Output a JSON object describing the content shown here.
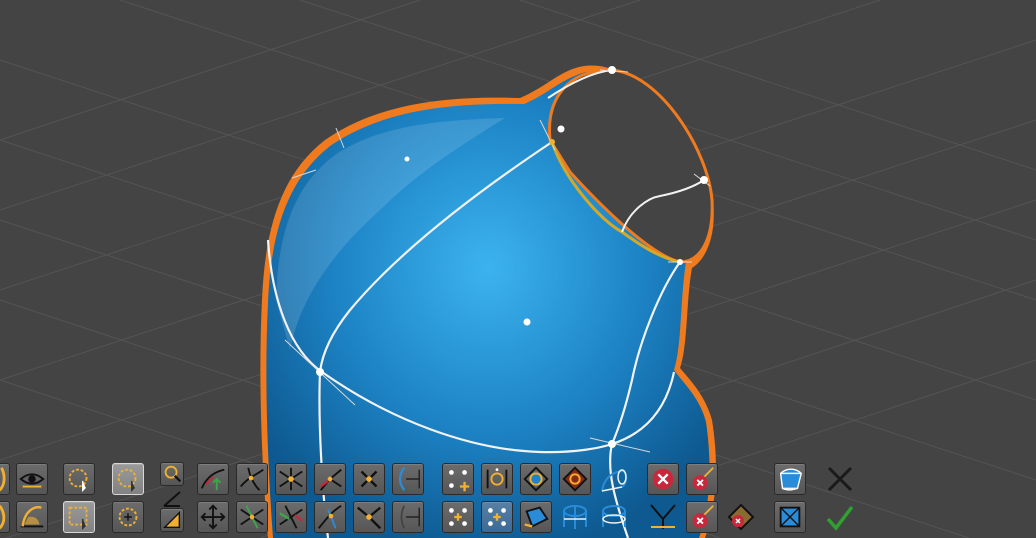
{
  "viewport": {
    "background": "#444444",
    "grid_color": "#555555",
    "surface_colors": [
      "#1e86c8",
      "#3db4ee",
      "#0f5a8e"
    ],
    "outline_color": "#f07b1f",
    "curve_color": "#f2f2f2"
  },
  "toolbar": {
    "top_row": [
      "curve-tool-icon",
      "eye-view-icon",
      "circle-select-icon",
      "circle-lasso-select-icon",
      "zoom-select-icon",
      "free-draw-icon",
      "crossing-curves-icon",
      "snap-point-icon",
      "split-curve-icon",
      "pin-point-icon",
      "straight-edge-icon",
      "point-selection-icon",
      "circle-point-icon",
      "circle-patch-icon",
      "red-patch-icon",
      "cone-surface-icon",
      "delete-x-icon",
      "delete-point-icon",
      "patch-edit-icon",
      "cancel-icon"
    ],
    "bottom_row": [
      "tilt-curve-icon",
      "arc-tool-icon",
      "rectangle-select-icon",
      "dashed-circle-select-icon",
      "angle-tool-icon",
      "move-arrows-icon",
      "cross-curve-icon",
      "extend-curve-icon",
      "tangent-curve-icon",
      "merge-curve-icon",
      "edge-line-icon",
      "point-group-icon",
      "point-group-selected-icon",
      "fill-patch-icon",
      "cylinder-icon",
      "cylinder-section-icon",
      "fork-curve-icon",
      "remove-point-icon",
      "remove-patch-icon",
      "patch-grid-icon",
      "confirm-icon"
    ],
    "colors": {
      "button": "#5f5f5f",
      "button_selected": "#8c8c8c",
      "accent": "#f2b032",
      "green": "#3ea64a",
      "red": "#c8283c",
      "blue": "#2a8cd8",
      "cancel": "#1a1a1a",
      "confirm": "#2ea12e"
    }
  }
}
